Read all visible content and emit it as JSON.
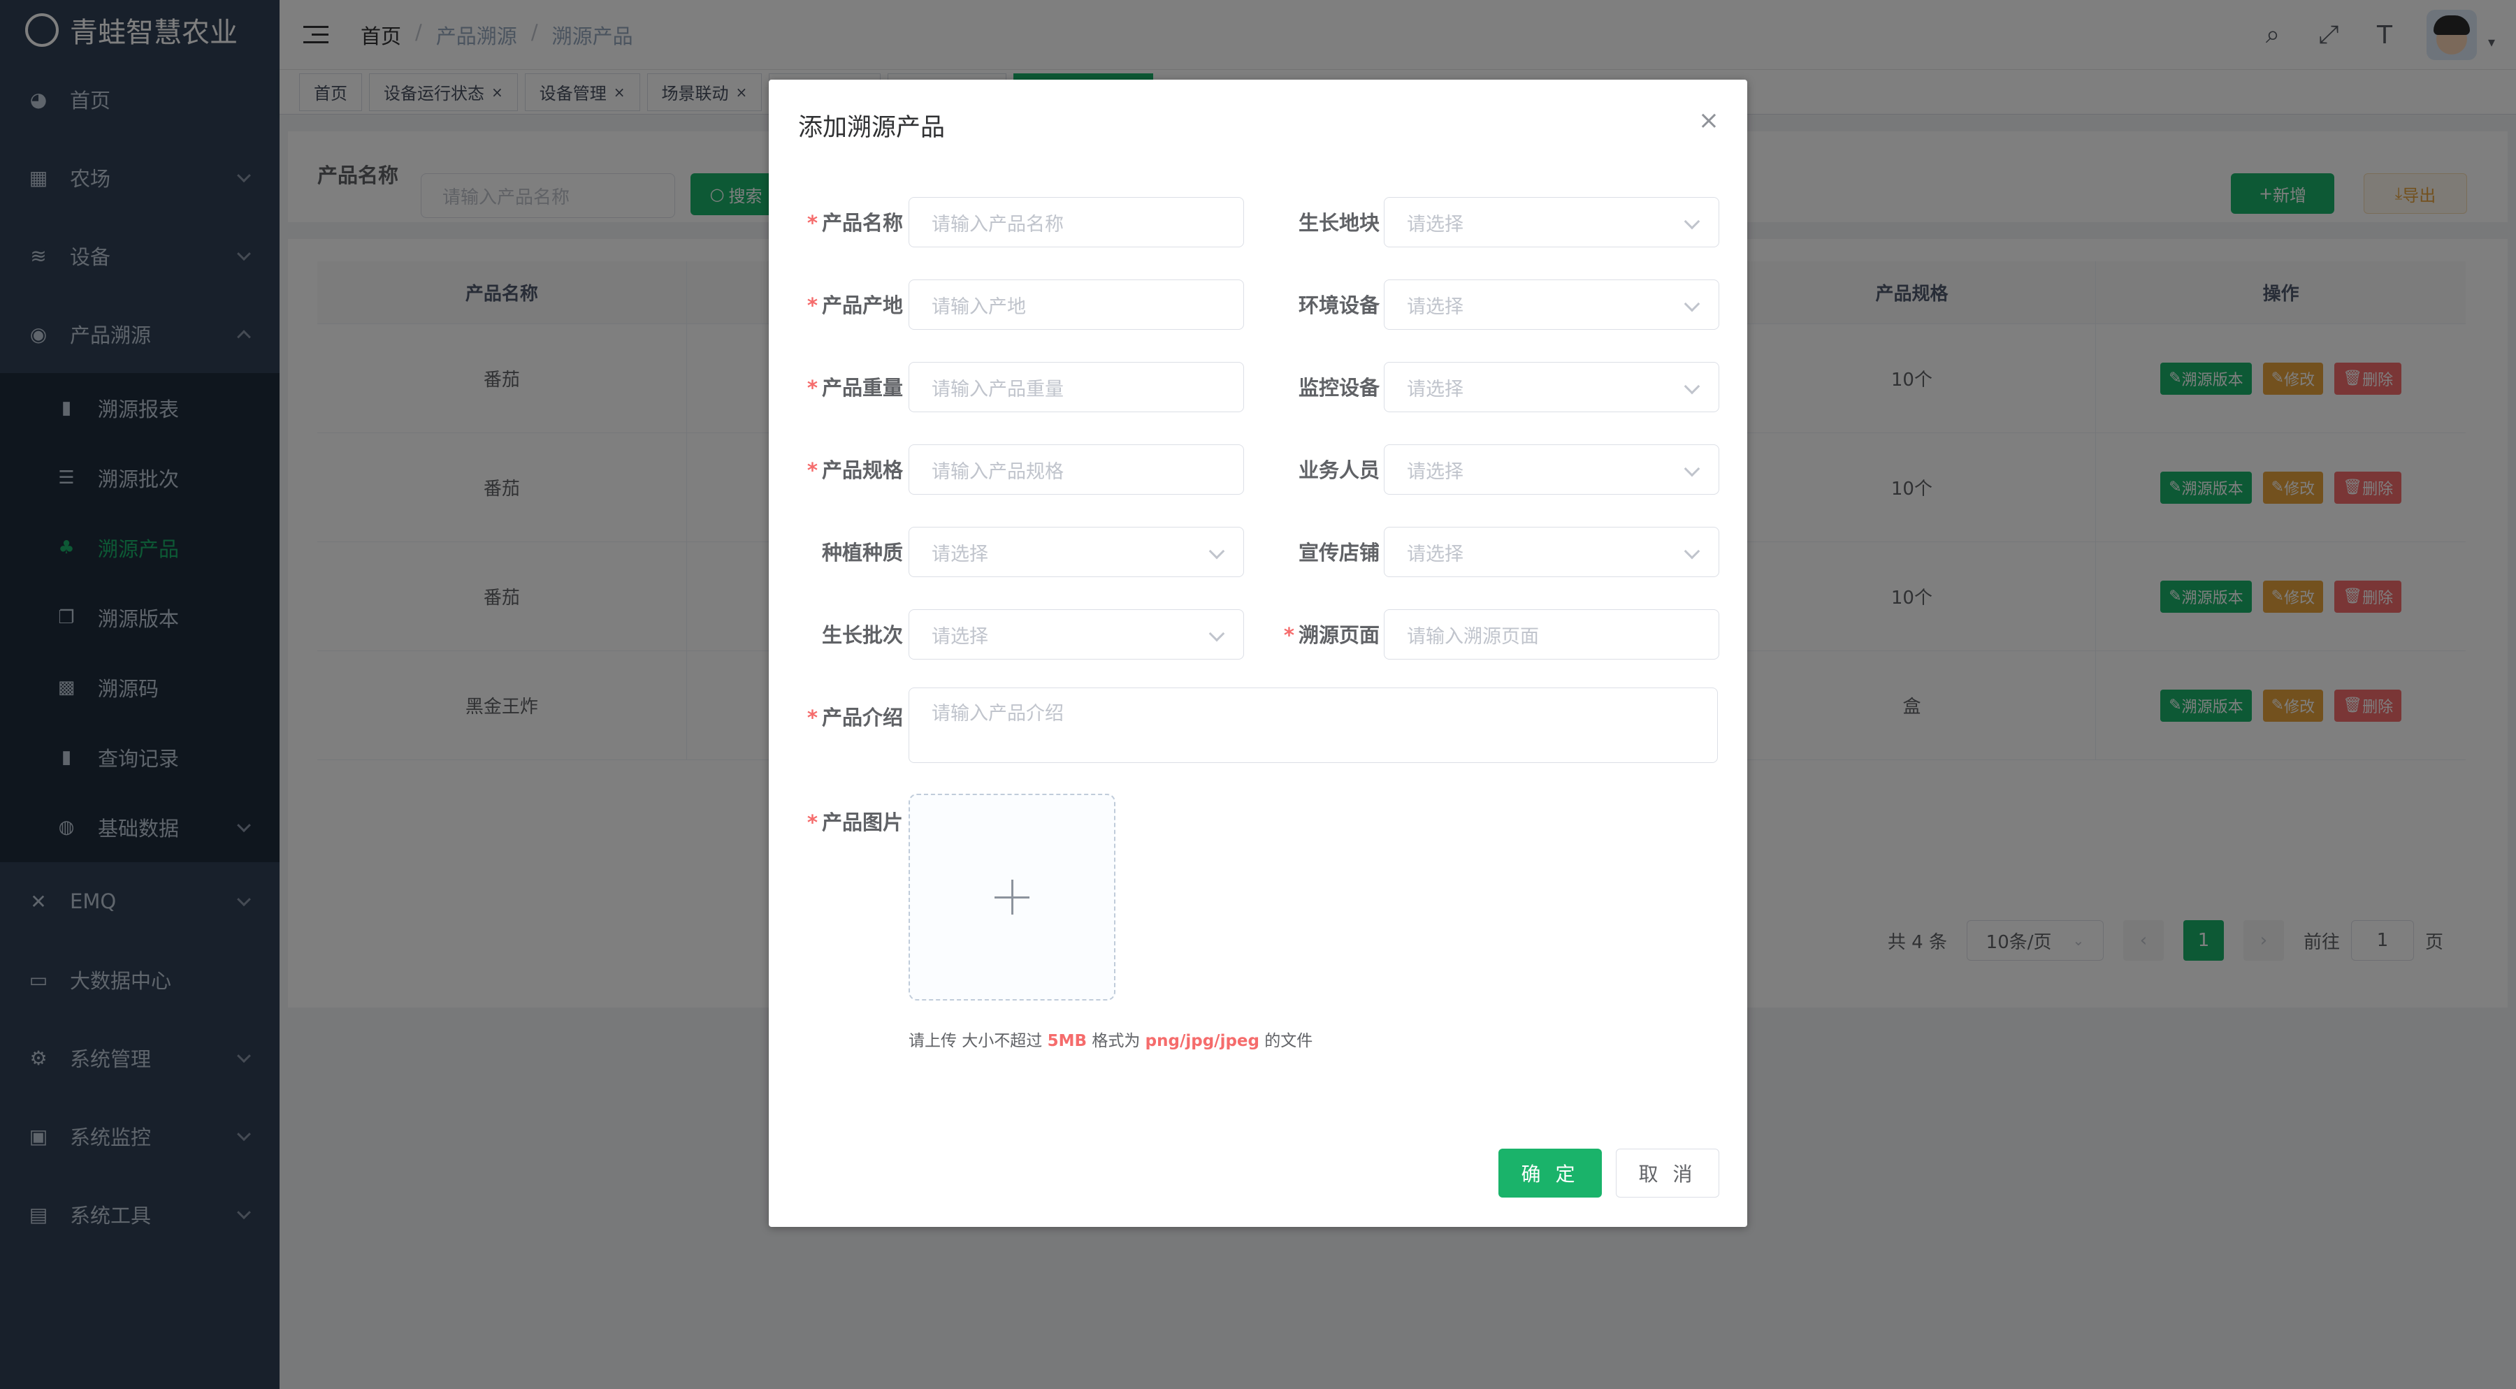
{
  "app": {
    "title": "青蛙智慧农业"
  },
  "sidebar": {
    "items": [
      {
        "label": "首页",
        "icon": "dashboard-icon"
      },
      {
        "label": "农场",
        "icon": "table-icon"
      },
      {
        "label": "设备",
        "icon": "device-icon"
      },
      {
        "label": "产品溯源",
        "icon": "trace-icon"
      }
    ],
    "sub_items": [
      {
        "label": "溯源报表",
        "icon": "chart-icon"
      },
      {
        "label": "溯源批次",
        "icon": "batch-icon"
      },
      {
        "label": "溯源产品",
        "icon": "product-icon"
      },
      {
        "label": "溯源版本",
        "icon": "version-icon"
      },
      {
        "label": "溯源码",
        "icon": "qrcode-icon"
      },
      {
        "label": "查询记录",
        "icon": "chart-icon"
      },
      {
        "label": "基础数据",
        "icon": "globe-icon"
      }
    ],
    "bottom_items": [
      {
        "label": "EMQ",
        "icon": "tools-icon"
      },
      {
        "label": "大数据中心",
        "icon": "monitor-icon"
      },
      {
        "label": "系统管理",
        "icon": "gear-icon"
      },
      {
        "label": "系统监控",
        "icon": "screen-icon"
      },
      {
        "label": "系统工具",
        "icon": "toolbox-icon"
      }
    ]
  },
  "breadcrumb": [
    "首页",
    "产品溯源",
    "溯源产品"
  ],
  "tags": [
    "首页",
    "设备运行状态",
    "设备管理",
    "场景联动"
  ],
  "search": {
    "label": "产品名称",
    "placeholder": "请输入产品名称",
    "button": "搜索"
  },
  "toolbar": {
    "add": "新增",
    "export": "导出"
  },
  "table": {
    "headers": [
      "产品名称",
      "产品规格",
      "操作"
    ],
    "rows": [
      {
        "name": "番茄",
        "spec": "10个"
      },
      {
        "name": "番茄",
        "spec": "10个"
      },
      {
        "name": "番茄",
        "spec": "10个"
      },
      {
        "name": "黑金王炸",
        "spec": "盒"
      }
    ],
    "ops": {
      "version": "溯源版本",
      "edit": "修改",
      "delete": "删除"
    }
  },
  "pagination": {
    "total": "共 4 条",
    "size": "10条/页",
    "current": "1",
    "goto": "前往",
    "page_value": "1",
    "page_unit": "页"
  },
  "dialog": {
    "title": "添加溯源产品",
    "fields": [
      {
        "label": "产品名称",
        "required": true,
        "placeholder": "请输入产品名称",
        "type": "input"
      },
      {
        "label": "生长地块",
        "required": false,
        "placeholder": "请选择",
        "type": "select"
      },
      {
        "label": "产品产地",
        "required": true,
        "placeholder": "请输入产地",
        "type": "input"
      },
      {
        "label": "环境设备",
        "required": false,
        "placeholder": "请选择",
        "type": "select"
      },
      {
        "label": "产品重量",
        "required": true,
        "placeholder": "请输入产品重量",
        "type": "input"
      },
      {
        "label": "监控设备",
        "required": false,
        "placeholder": "请选择",
        "type": "select"
      },
      {
        "label": "产品规格",
        "required": true,
        "placeholder": "请输入产品规格",
        "type": "input"
      },
      {
        "label": "业务人员",
        "required": false,
        "placeholder": "请选择",
        "type": "select"
      },
      {
        "label": "种植种质",
        "required": false,
        "placeholder": "请选择",
        "type": "select"
      },
      {
        "label": "宣传店铺",
        "required": false,
        "placeholder": "请选择",
        "type": "select"
      },
      {
        "label": "生长批次",
        "required": false,
        "placeholder": "请选择",
        "type": "select"
      },
      {
        "label": "溯源页面",
        "required": true,
        "placeholder": "请输入溯源页面",
        "type": "input"
      }
    ],
    "intro": {
      "label": "产品介绍",
      "placeholder": "请输入产品介绍"
    },
    "image": {
      "label": "产品图片"
    },
    "tip": {
      "prefix": "请上传 大小不超过 ",
      "size": "5MB",
      "middle": " 格式为 ",
      "formats": "png/jpg/jpeg",
      "suffix": " 的文件"
    },
    "confirm": "确 定",
    "cancel": "取 消"
  },
  "colors": {
    "primary": "#1ab36a",
    "sidebar": "#304156",
    "danger": "#f56c6c",
    "warning": "#e6a23c"
  }
}
